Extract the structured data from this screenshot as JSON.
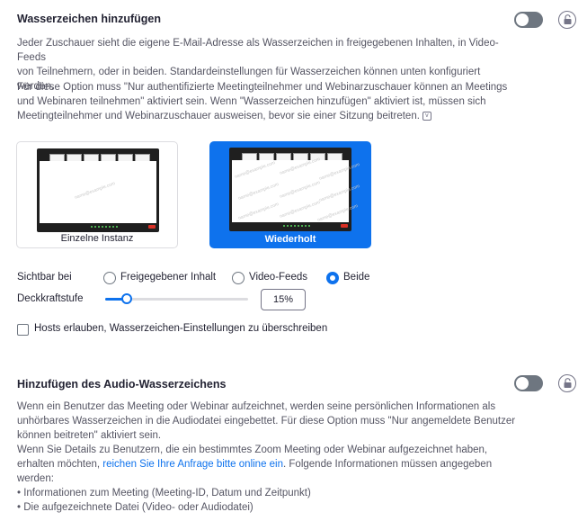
{
  "watermark": {
    "title": "Wasserzeichen hinzufügen",
    "toggle_state": "off",
    "desc1_line1": "Jeder Zuschauer sieht die eigene E-Mail-Adresse als Wasserzeichen in freigegebenen Inhalten, in Video-Feeds",
    "desc1_line2": "von Teilnehmern, oder in beiden. Standardeinstellungen für Wasserzeichen können unten konfiguriert werden.",
    "desc2_line1": "Für diese Option muss \"Nur authentifizierte Meetingteilnehmer und Webinarzuschauer können an Meetings",
    "desc2_line2": "und Webinaren teilnehmen\" aktiviert sein. Wenn \"Wasserzeichen hinzufügen\" aktiviert ist, müssen sich",
    "desc2_line3": "Meetingteilnehmer und Webinarzuschauer ausweisen, bevor sie einer Sitzung beitreten.",
    "info_icon": "info-icon",
    "cards": {
      "single_label": "Einzelne Instanz",
      "repeat_label": "Wiederholt",
      "selected": "Wiederholt",
      "thumb_text": "name@example.com"
    },
    "visible_label": "Sichtbar bei",
    "radios": {
      "option1": "Freigegebener Inhalt",
      "option2": "Video-Feeds",
      "option3": "Beide",
      "selected": "Beide"
    },
    "opacity_label": "Deckkraftstufe",
    "opacity_value": "15%",
    "opacity_fraction": 0.15,
    "allow_hosts_label": "Hosts erlauben, Wasserzeichen-Einstellungen zu überschreiben",
    "allow_hosts_checked": false
  },
  "audio": {
    "title": "Hinzufügen des Audio-Wasserzeichens",
    "toggle_state": "off",
    "desc_line1": "Wenn ein Benutzer das Meeting oder Webinar aufzeichnet, werden seine persönlichen Informationen als",
    "desc_line2": "unhörbares Wasserzeichen in die Audiodatei eingebettet. Für diese Option muss \"Nur angemeldete Benutzer",
    "desc_line3": "können beitreten\" aktiviert sein.",
    "desc_line4": "Wenn Sie Details zu Benutzern, die ein bestimmtes Zoom Meeting oder Webinar aufgezeichnet haben,",
    "desc_line5_pre": "erhalten möchten, ",
    "desc_line5_link": "reichen Sie Ihre Anfrage bitte online ein",
    "desc_line5_post": ". Folgende Informationen müssen angegeben",
    "desc_line6": "werden:",
    "bullet1": "• Informationen zum Meeting (Meeting-ID, Datum und Zeitpunkt)",
    "bullet2": "• Die aufgezeichnete Datei (Video- oder Audiodatei)"
  },
  "colors": {
    "accent": "#0e72ed",
    "toggle_off": "#6e7680"
  }
}
